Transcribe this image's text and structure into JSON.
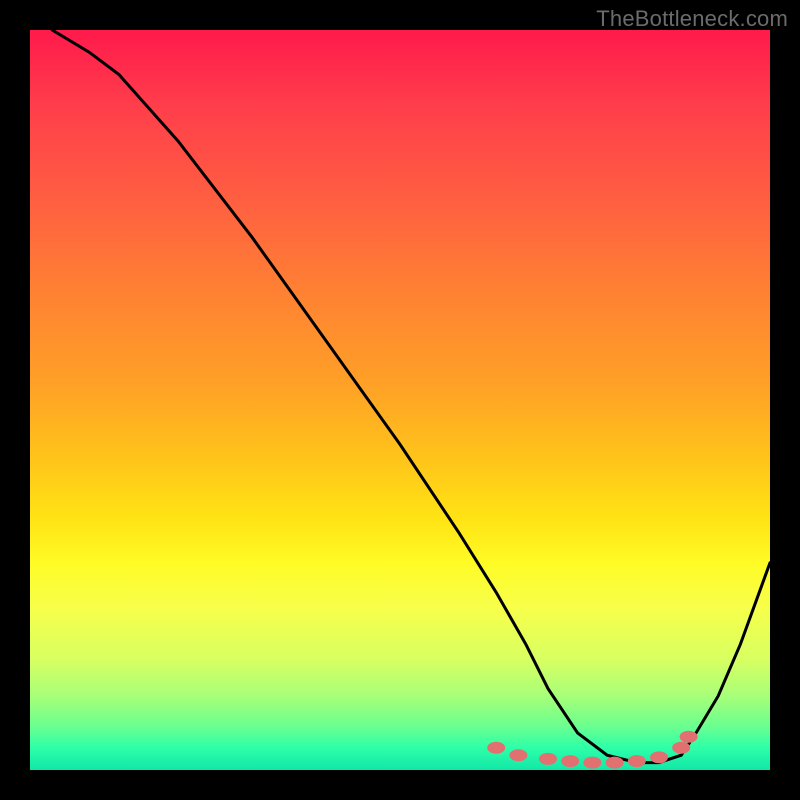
{
  "watermark": "TheBottleneck.com",
  "chart_data": {
    "type": "line",
    "title": "",
    "xlabel": "",
    "ylabel": "",
    "xlim": [
      0,
      100
    ],
    "ylim": [
      0,
      100
    ],
    "grid": false,
    "legend": false,
    "series": [
      {
        "name": "bottleneck-curve",
        "x": [
          3,
          8,
          12,
          20,
          30,
          40,
          50,
          58,
          63,
          67,
          70,
          74,
          78,
          82,
          85,
          88,
          90,
          93,
          96,
          100
        ],
        "values": [
          100,
          97,
          94,
          85,
          72,
          58,
          44,
          32,
          24,
          17,
          11,
          5,
          2,
          1,
          1,
          2,
          5,
          10,
          17,
          28
        ]
      }
    ],
    "markers": {
      "name": "highlight-dots",
      "x": [
        63,
        66,
        70,
        73,
        76,
        79,
        82,
        85,
        88,
        89
      ],
      "values": [
        3,
        2,
        1.5,
        1.2,
        1.0,
        1.0,
        1.2,
        1.7,
        3.0,
        4.5
      ]
    }
  }
}
